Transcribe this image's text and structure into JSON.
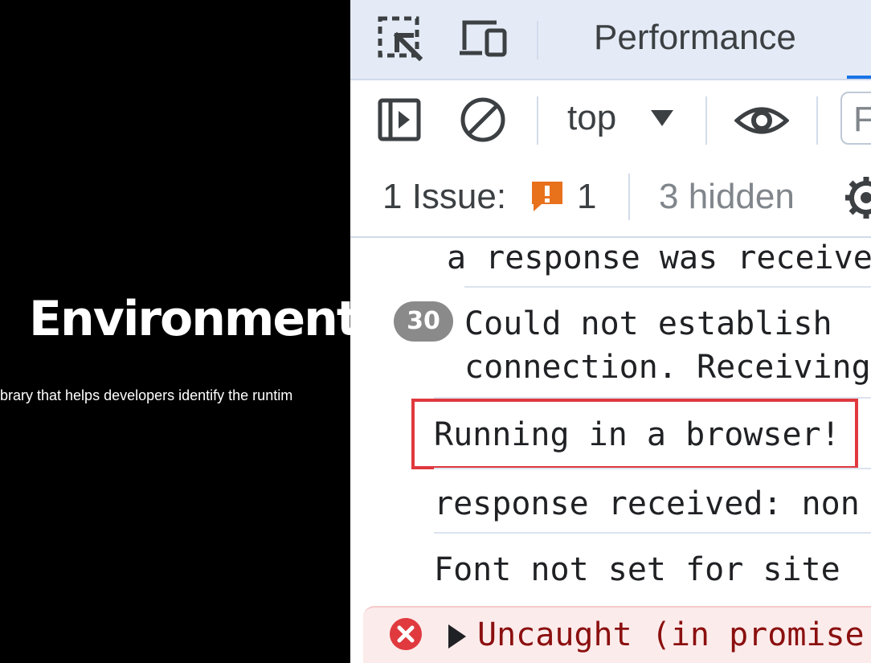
{
  "page": {
    "title": "Environment",
    "subtitle": "brary that helps developers identify the runtim"
  },
  "devtools": {
    "tabs": {
      "active_label": "Performance"
    },
    "toolbar": {
      "context": "top",
      "filter_placeholder": "F"
    },
    "issues": {
      "label": "1 Issue:",
      "count": "1",
      "hidden": "3 hidden"
    },
    "console": {
      "messages": [
        {
          "text": "a response was receive"
        },
        {
          "count": "30",
          "line1": "Could not establish",
          "line2": "connection. Receiving"
        },
        {
          "text": "Running in a browser!"
        },
        {
          "text": "response received: non"
        },
        {
          "text": "Font not set for site"
        },
        {
          "text": "Uncaught (in promise"
        }
      ]
    }
  },
  "colors": {
    "highlight": "#e0393e",
    "error_bg": "#fcebeb",
    "tabbar_bg": "#e4ebf6",
    "issue_orange": "#e8711c"
  }
}
